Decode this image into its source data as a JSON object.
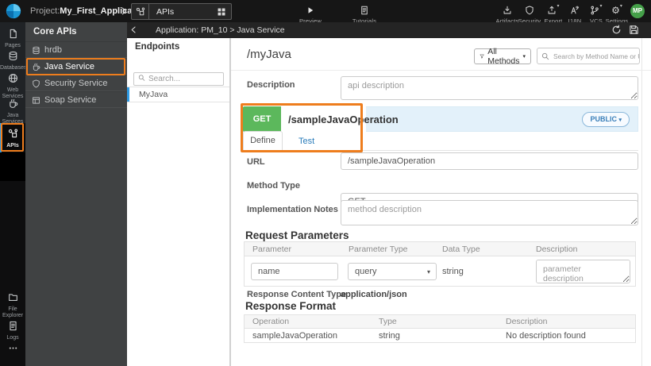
{
  "topbar": {
    "project_prefix": "Project:",
    "project_name": "My_First_Application",
    "selector_label": "APIs",
    "preview_label": "Preview",
    "tutorials_label": "Tutorials",
    "right_items": [
      {
        "label": "Artifacts"
      },
      {
        "label": "Security"
      },
      {
        "label": "Export"
      },
      {
        "label": "I18N"
      },
      {
        "label": "VCS"
      },
      {
        "label": "Settings"
      }
    ],
    "avatar_initials": "MP"
  },
  "activity_bar": {
    "items": [
      {
        "label": "Pages"
      },
      {
        "label": "Databases"
      },
      {
        "label": "Web Services"
      },
      {
        "label": "Java Services"
      },
      {
        "label": "APIs",
        "active": true
      }
    ],
    "bottom_items": [
      {
        "label": "File Explorer"
      },
      {
        "label": "Logs"
      }
    ]
  },
  "core_apis": {
    "title": "Core APIs",
    "items": [
      {
        "label": "hrdb"
      },
      {
        "label": "Java Service",
        "highlighted": true
      },
      {
        "label": "Security Service"
      },
      {
        "label": "Soap Service"
      }
    ]
  },
  "app_bar": {
    "title": "Application: PM_10 > Java Service"
  },
  "endpoints": {
    "title": "Endpoints",
    "search_placeholder": "Search...",
    "items": [
      {
        "label": "MyJava",
        "selected": true
      }
    ]
  },
  "main": {
    "service_path": "/myJava",
    "methods_filter_label": "All Methods",
    "method_search_placeholder": "Search by Method Name or URL...",
    "description_label": "Description",
    "description_placeholder": "api description",
    "operation": {
      "method": "GET",
      "path": "/sampleJavaOperation",
      "visibility": "PUBLIC"
    },
    "tabs": [
      {
        "label": "Define",
        "active": true
      },
      {
        "label": "Test"
      }
    ],
    "url_label": "URL",
    "url_value": "/sampleJavaOperation",
    "method_type_label": "Method Type",
    "method_type_value": "GET",
    "impl_notes_label": "Implementation Notes",
    "impl_notes_placeholder": "method description",
    "request_parameters": {
      "title": "Request Parameters",
      "columns": [
        "Parameter",
        "Parameter Type",
        "Data Type",
        "Description"
      ],
      "row": {
        "parameter_value": "name",
        "parameter_type_value": "query",
        "data_type": "string",
        "description_placeholder": "parameter description"
      }
    },
    "response_content_type_label": "Response Content Type",
    "response_content_type_value": "application/json",
    "response_format": {
      "title": "Response Format",
      "columns": [
        "Operation",
        "Type",
        "Description"
      ],
      "rows": [
        {
          "operation": "sampleJavaOperation",
          "type": "string",
          "description": "No description found"
        }
      ]
    }
  },
  "colors": {
    "annotation_orange": "#ee7d1d",
    "method_get_green": "#5cb85c",
    "operation_row_blue": "#e3f1fa",
    "active_item_blue": "#2f9be3",
    "topbar_bg": "#161616",
    "panel_gray": "#404243"
  },
  "icons": [
    "wavemaker-logo",
    "chevron-right",
    "api",
    "grid",
    "play",
    "document",
    "download",
    "shield",
    "upload",
    "translate",
    "branch",
    "gear",
    "page",
    "database",
    "globe",
    "coffee",
    "folder",
    "dots",
    "search",
    "funnel",
    "refresh",
    "save",
    "chevron-left"
  ]
}
